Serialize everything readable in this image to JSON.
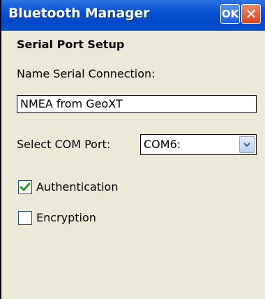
{
  "window": {
    "title": "Bluetooth Manager",
    "ok_label": "OK",
    "close_label": "✕"
  },
  "form": {
    "section_title": "Serial Port Setup",
    "name_label": "Name Serial Connection:",
    "name_value": "NMEA from GeoXT",
    "com_label": "Select COM Port:",
    "com_value": "COM6:",
    "authentication": {
      "label": "Authentication",
      "checked": true
    },
    "encryption": {
      "label": "Encryption",
      "checked": false
    }
  }
}
